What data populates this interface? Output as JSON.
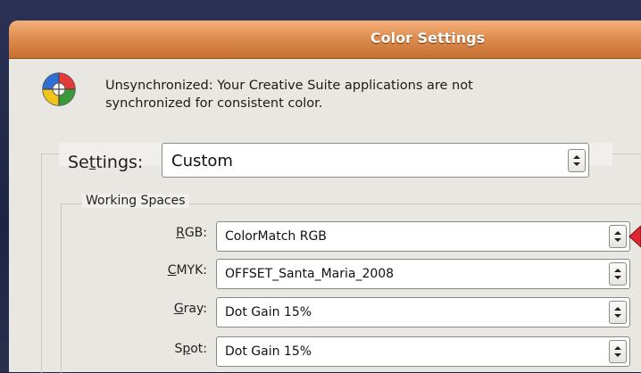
{
  "window": {
    "title": "Color Settings"
  },
  "sync": {
    "icon": "color-sync-icon",
    "line1": "Unsynchronized: Your Creative Suite applications are not",
    "line2": "synchronized for consistent color."
  },
  "settings": {
    "label_pre": "Se",
    "label_ul": "t",
    "label_post": "tings:",
    "value": "Custom"
  },
  "working_spaces": {
    "title": "Working Spaces",
    "fields": [
      {
        "label_ul": "R",
        "label_rest": "GB:",
        "value": "ColorMatch RGB"
      },
      {
        "label_ul": "C",
        "label_rest": "MYK:",
        "value": "OFFSET_Santa_Maria_2008"
      },
      {
        "label_ul": "G",
        "label_rest": "ray:",
        "value": "Dot Gain 15%"
      },
      {
        "label_pre": "S",
        "label_ul": "p",
        "label_rest": "ot:",
        "value": "Dot Gain 15%"
      }
    ]
  },
  "colors": {
    "titlebar": "#de8d4f",
    "dialog_bg": "#f0efeb",
    "pointer": "#e0262e"
  }
}
